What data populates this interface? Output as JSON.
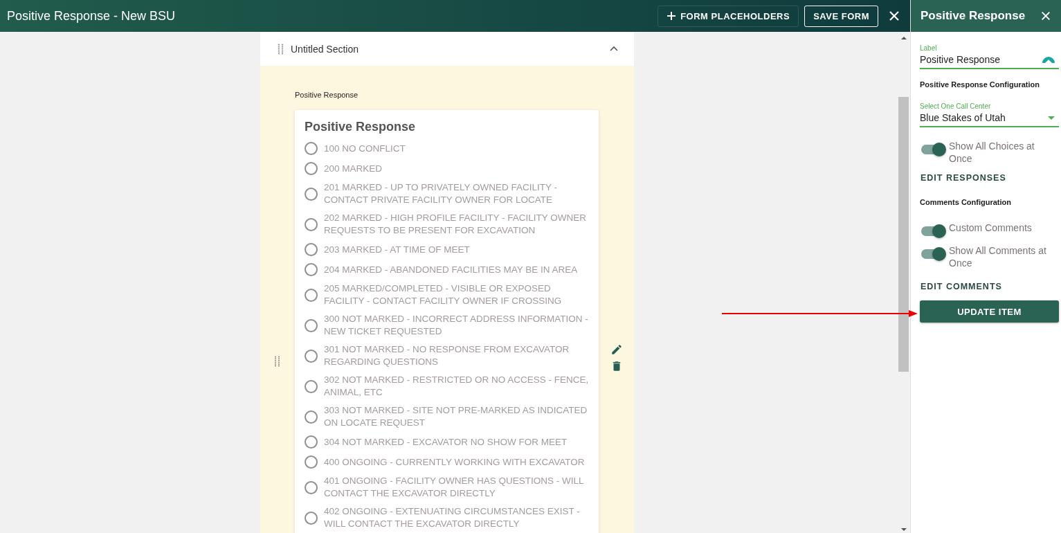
{
  "header": {
    "title": "Positive Response - New BSU",
    "buttons": [
      {
        "kind": "add",
        "label": "FORM PLACEHOLDERS"
      },
      {
        "kind": "save",
        "label": "SAVE FORM"
      }
    ]
  },
  "section": {
    "title": "Untitled Section",
    "expanded": true,
    "field_label": "Positive Response",
    "card": {
      "title": "Positive Response",
      "choices": [
        {
          "label": "100 NO CONFLICT",
          "selected": false
        },
        {
          "label": "200 MARKED",
          "selected": false
        },
        {
          "label": "201 MARKED - UP TO PRIVATELY OWNED FACILITY - CONTACT PRIVATE FACILITY OWNER FOR LOCATE",
          "selected": false
        },
        {
          "label": "202 MARKED - HIGH PROFILE FACILITY - FACILITY OWNER REQUESTS TO BE PRESENT FOR EXCAVATION",
          "selected": false
        },
        {
          "label": "203 MARKED - AT TIME OF MEET",
          "selected": false
        },
        {
          "label": "204 MARKED - ABANDONED FACILITIES MAY BE IN AREA",
          "selected": false
        },
        {
          "label": "205 MARKED/COMPLETED - VISIBLE OR EXPOSED FACILITY - CONTACT FACILITY OWNER IF CROSSING",
          "selected": false
        },
        {
          "label": "300 NOT MARKED - INCORRECT ADDRESS INFORMATION - NEW TICKET REQUESTED",
          "selected": false
        },
        {
          "label": "301 NOT MARKED - NO RESPONSE FROM EXCAVATOR REGARDING QUESTIONS",
          "selected": false
        },
        {
          "label": "302 NOT MARKED - RESTRICTED OR NO ACCESS - FENCE, ANIMAL, ETC",
          "selected": false
        },
        {
          "label": "303 NOT MARKED - SITE NOT PRE-MARKED AS INDICATED ON LOCATE REQUEST",
          "selected": false
        },
        {
          "label": "304 NOT MARKED - EXCAVATOR NO SHOW FOR MEET",
          "selected": false
        },
        {
          "label": "400 ONGOING - CURRENTLY WORKING WITH EXCAVATOR",
          "selected": false
        },
        {
          "label": "401 ONGOING - FACILITY OWNER HAS QUESTIONS - WILL CONTACT THE EXCAVATOR DIRECTLY",
          "selected": false
        },
        {
          "label": "402 ONGOING - EXTENUATING CIRCUMSTANCES EXIST - WILL CONTACT THE EXCAVATOR DIRECTLY",
          "selected": false
        }
      ]
    }
  },
  "panel": {
    "title": "Positive Response",
    "label_field": {
      "label": "Label",
      "value": "Positive Response"
    },
    "config_heading": "Positive Response Configuration",
    "call_center": {
      "label": "Select One Call Center",
      "value": "Blue Stakes of Utah"
    },
    "choices_toggle": {
      "label": "Show All Choices at Once",
      "on": true
    },
    "edit_responses": "EDIT RESPONSES",
    "comments_heading": "Comments Configuration",
    "comment_toggles": [
      {
        "label": "Custom Comments",
        "on": true
      },
      {
        "label": "Show All Comments at Once",
        "on": true
      }
    ],
    "edit_comments": "EDIT COMMENTS",
    "update_button": "UPDATE ITEM"
  }
}
